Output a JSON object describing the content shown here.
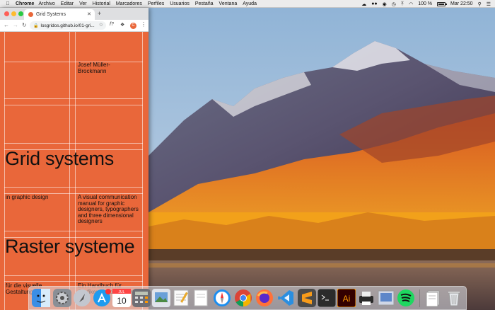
{
  "menubar": {
    "app": "Chrome",
    "items": [
      "Archivo",
      "Editar",
      "Ver",
      "Historial",
      "Marcadores",
      "Perfiles",
      "Usuarios",
      "Pestaña",
      "Ventana",
      "Ayuda"
    ],
    "battery": "100 %",
    "clock": "Mar 22:50"
  },
  "browser": {
    "tab_title": "Grid Systems",
    "url": "losgridos.github.io/01-gri...",
    "profile_initial": "G"
  },
  "page": {
    "author": "Josef Müller-Brockmann",
    "title_en": "Grid systems",
    "subtitle_en": "in graphic design",
    "desc_en": "A visual communication manual for graphic designers, typographers and three dimensional designers",
    "title_de": "Raster systeme",
    "subtitle_de": "für die visuelle Gestaltung",
    "desc_de": "Ein Handbuch für Grafiker, Typographen"
  },
  "dock": {
    "calendar_day": "10",
    "calendar_month": "JUL",
    "ai_label": "Ai"
  },
  "colors": {
    "page_bg": "#e9673a",
    "grid_line": "#ffffff",
    "menubar_bg": "#ececec"
  }
}
